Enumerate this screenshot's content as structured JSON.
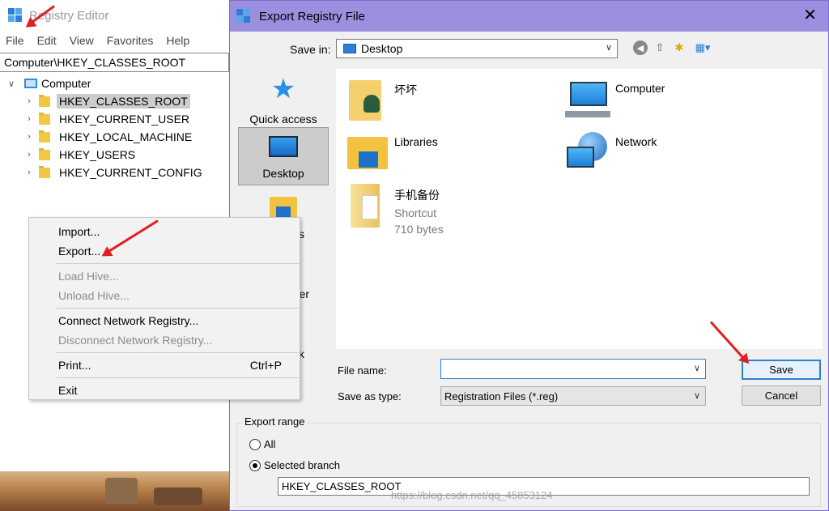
{
  "registry_editor": {
    "title": "Registry Editor",
    "menu": [
      "File",
      "Edit",
      "View",
      "Favorites",
      "Help"
    ],
    "address": "Computer\\HKEY_CLASSES_ROOT",
    "tree": {
      "root": "Computer",
      "keys": [
        "HKEY_CLASSES_ROOT",
        "HKEY_CURRENT_USER",
        "HKEY_LOCAL_MACHINE",
        "HKEY_USERS",
        "HKEY_CURRENT_CONFIG"
      ],
      "selected": "HKEY_CLASSES_ROOT"
    }
  },
  "context_menu": {
    "import": "Import...",
    "export": "Export...",
    "load_hive": "Load Hive...",
    "unload_hive": "Unload Hive...",
    "connect": "Connect Network Registry...",
    "disconnect": "Disconnect Network Registry...",
    "print": "Print...",
    "print_shortcut": "Ctrl+P",
    "exit": "Exit"
  },
  "dialog": {
    "title": "Export Registry File",
    "save_in_label": "Save in:",
    "save_in_value": "Desktop",
    "places": {
      "quick_access": "Quick access",
      "desktop": "Desktop",
      "libraries_partial": "s",
      "computer_partial": "er",
      "network_partial": "k"
    },
    "files": [
      {
        "name": "坏坏"
      },
      {
        "name": "Computer"
      },
      {
        "name": "Libraries"
      },
      {
        "name": "Network"
      },
      {
        "name": "手机备份",
        "type": "Shortcut",
        "size": "710 bytes"
      }
    ],
    "file_name_label": "File name:",
    "file_name_value": "",
    "save_as_type_label": "Save as type:",
    "save_as_type_value": "Registration Files (*.reg)",
    "save_button": "Save",
    "cancel_button": "Cancel",
    "export_range": {
      "legend": "Export range",
      "all": "All",
      "selected_branch": "Selected branch",
      "branch_value": "HKEY_CLASSES_ROOT",
      "selected": "Selected branch"
    }
  },
  "watermark": "https://blog.csdn.net/qq_45853124",
  "accent_color": "#2f7fd1",
  "dialog_title_color": "#9b8fe0",
  "annotation_color": "#e02020"
}
